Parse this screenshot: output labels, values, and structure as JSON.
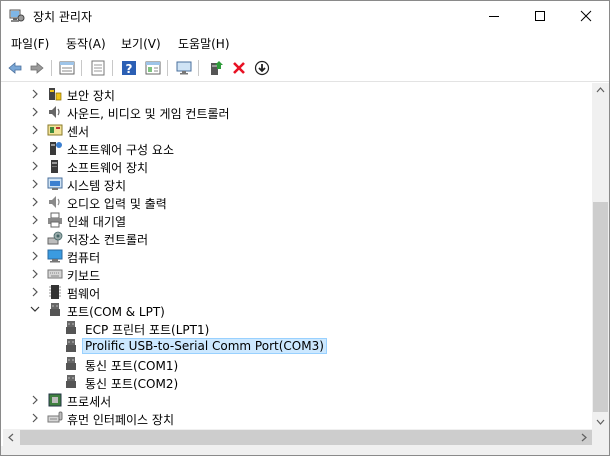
{
  "window": {
    "title": "장치 관리자"
  },
  "menu": {
    "file": "파일(F)",
    "action": "동작(A)",
    "view": "보기(V)",
    "help": "도움말(H)"
  },
  "toolbar": {
    "icons": [
      "back-icon",
      "forward-icon",
      "properties-view-icon",
      "show-hidden-icon",
      "help-icon",
      "console-tree-icon",
      "monitor-icon",
      "update-driver-icon",
      "uninstall-icon",
      "disable-icon"
    ]
  },
  "tree": {
    "items": [
      {
        "label": "보안 장치",
        "expanded": false
      },
      {
        "label": "사운드, 비디오 및 게임 컨트롤러",
        "expanded": false
      },
      {
        "label": "센서",
        "expanded": false
      },
      {
        "label": "소프트웨어 구성 요소",
        "expanded": false
      },
      {
        "label": "소프트웨어 장치",
        "expanded": false
      },
      {
        "label": "시스템 장치",
        "expanded": false
      },
      {
        "label": "오디오 입력 및 출력",
        "expanded": false
      },
      {
        "label": "인쇄 대기열",
        "expanded": false
      },
      {
        "label": "저장소 컨트롤러",
        "expanded": false
      },
      {
        "label": "컴퓨터",
        "expanded": false
      },
      {
        "label": "키보드",
        "expanded": false
      },
      {
        "label": "펌웨어",
        "expanded": false
      },
      {
        "label": "포트(COM & LPT)",
        "expanded": true
      },
      {
        "label": "ECP 프린터 포트(LPT1)"
      },
      {
        "label": "Prolific USB-to-Serial Comm Port(COM3)",
        "selected": true
      },
      {
        "label": "통신 포트(COM1)"
      },
      {
        "label": "통신 포트(COM2)"
      },
      {
        "label": "프로세서",
        "expanded": false
      },
      {
        "label": "휴먼 인터페이스 장치",
        "expanded": false
      }
    ]
  },
  "colors": {
    "selection": "#cce8ff",
    "selection_border": "#99d1ff",
    "uninstall_red": "#e81123",
    "help_blue": "#2b5fb4"
  }
}
